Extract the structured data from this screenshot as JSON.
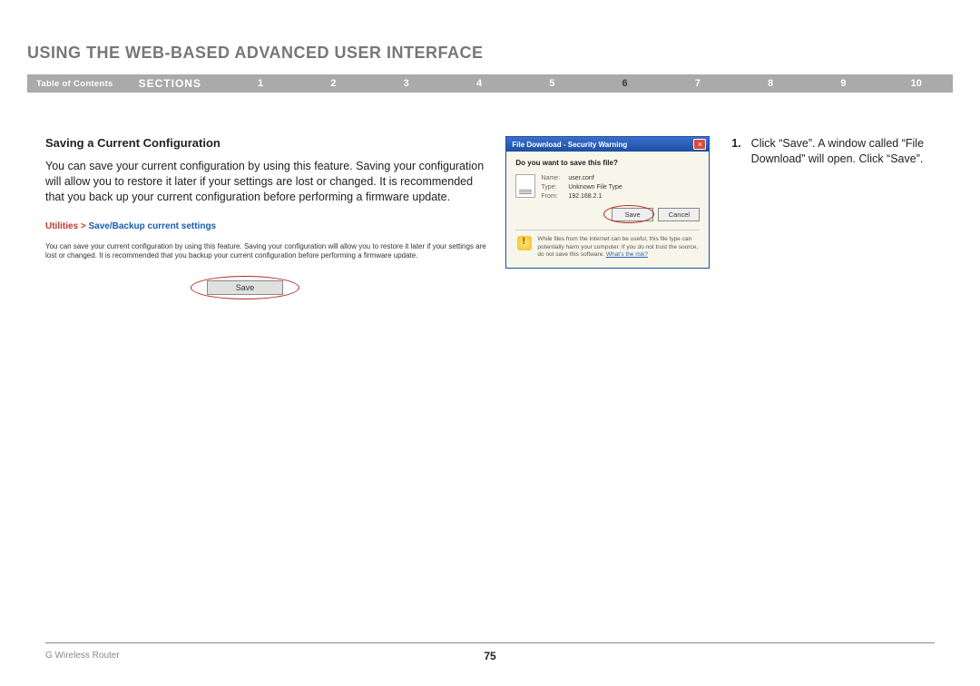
{
  "header": {
    "title": "USING THE WEB-BASED ADVANCED USER INTERFACE"
  },
  "nav": {
    "toc": "Table of Contents",
    "sections_label": "SECTIONS",
    "items": [
      "1",
      "2",
      "3",
      "4",
      "5",
      "6",
      "7",
      "8",
      "9",
      "10"
    ],
    "active": "6"
  },
  "section": {
    "subtitle": "Saving a Current Configuration",
    "intro": "You can save your current configuration by using this feature. Saving your configuration will allow you to restore it later if your settings are lost or changed. It is recommended that you back up your current configuration before performing a firmware update.",
    "breadcrumb_a": "Utilities > ",
    "breadcrumb_b": "Save/Backup current settings",
    "small_text": "You can save your current configuration by using this feature. Saving your configuration will allow you to restore it later if your settings are lost or changed. It is recommended that you backup your current configuration before performing a firmware update.",
    "save_button": "Save"
  },
  "dialog": {
    "title": "File Download - Security Warning",
    "prompt": "Do you want to save this file?",
    "file_name_label": "Name:",
    "file_name": "user.conf",
    "file_type_label": "Type:",
    "file_type": "Unknown File Type",
    "file_from_label": "From:",
    "file_from": "192.168.2.1",
    "btn_save": "Save",
    "btn_cancel": "Cancel",
    "warning_text": "While files from the Internet can be useful, this file type can potentially harm your computer. If you do not trust the source, do not save this software. ",
    "warning_link": "What's the risk?"
  },
  "steps": {
    "s1_num": "1.",
    "s1_text": "Click “Save”. A window called “File Download” will open. Click “Save”."
  },
  "footer": {
    "product": "G Wireless Router",
    "page": "75"
  }
}
